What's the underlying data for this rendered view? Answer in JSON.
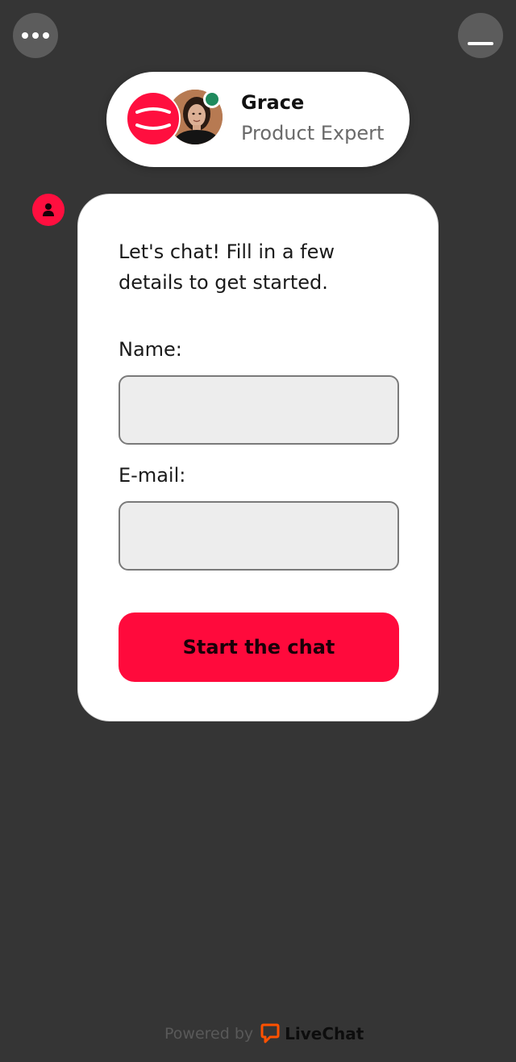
{
  "header": {
    "menu_icon": "ellipsis-icon",
    "minimize_icon": "minimize-icon"
  },
  "agent": {
    "name": "Grace",
    "role": "Product Expert",
    "status": "online",
    "status_color": "#1f8a5d",
    "logo_icon": "brand-logo-icon"
  },
  "form": {
    "intro": "Let's chat! Fill in a few details to get started.",
    "name_label": "Name:",
    "name_value": "",
    "email_label": "E-mail:",
    "email_value": "",
    "submit_label": "Start the chat"
  },
  "footer": {
    "powered_by": "Powered by",
    "brand": "LiveChat",
    "brand_icon": "livechat-logo-icon"
  },
  "colors": {
    "background": "#353535",
    "accent": "#ff0a3c",
    "online": "#1f8a5d",
    "livechat_orange": "#ff5100"
  }
}
